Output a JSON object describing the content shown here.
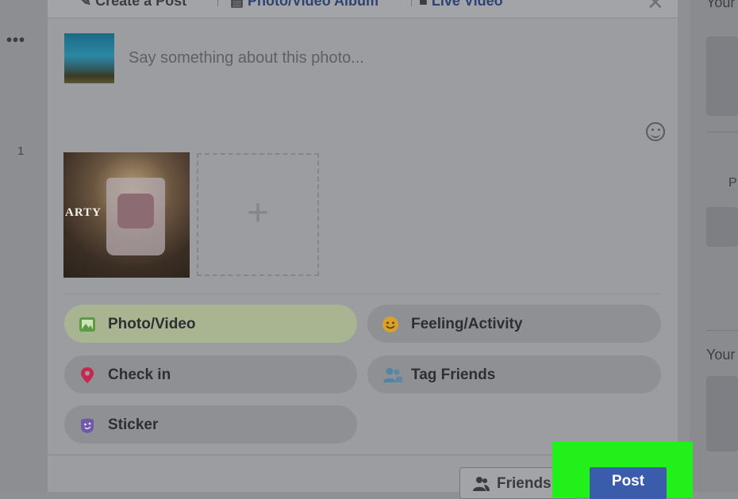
{
  "tabs": {
    "create_post": "Create a Post",
    "photo_album": "Photo/Video Album",
    "live_video": "Live Video"
  },
  "composer": {
    "placeholder": "Say something about this photo..."
  },
  "attached_photo": {
    "overlay_text": "ARTY"
  },
  "actions": [
    {
      "label": "Photo/Video",
      "icon": "photo-icon",
      "selected": true
    },
    {
      "label": "Feeling/Activity",
      "icon": "smiley-icon"
    },
    {
      "label": "Check in",
      "icon": "location-pin-icon"
    },
    {
      "label": "Tag Friends",
      "icon": "tag-friends-icon"
    },
    {
      "label": "Sticker",
      "icon": "sticker-icon"
    }
  ],
  "footer": {
    "privacy_label": "Friends",
    "post_label": "Post"
  },
  "background": {
    "left_number": "1",
    "right_heading_1": "Your",
    "right_label_p": "P",
    "right_heading_2": "Your"
  },
  "colors": {
    "post_button": "#3b5cab",
    "highlight": "#22f01a",
    "selected_pill": "#a8b590"
  }
}
